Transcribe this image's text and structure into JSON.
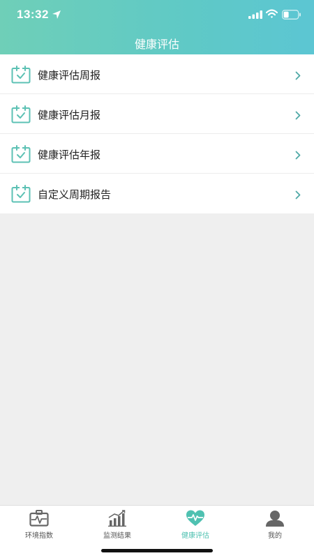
{
  "status": {
    "time": "13:32",
    "icons": [
      "location-arrow-icon",
      "signal-icon",
      "wifi-icon",
      "battery-icon"
    ]
  },
  "header": {
    "title": "健康评估"
  },
  "menu": {
    "items": [
      {
        "label": "健康评估周报",
        "icon": "calendar-check-icon"
      },
      {
        "label": "健康评估月报",
        "icon": "calendar-check-icon"
      },
      {
        "label": "健康评估年报",
        "icon": "calendar-check-icon"
      },
      {
        "label": "自定义周期报告",
        "icon": "calendar-check-icon"
      }
    ]
  },
  "tabbar": {
    "tabs": [
      {
        "label": "环境指数",
        "icon": "medkit-icon",
        "active": false
      },
      {
        "label": "监测结果",
        "icon": "bar-chart-icon",
        "active": false
      },
      {
        "label": "健康评估",
        "icon": "heart-pulse-icon",
        "active": true
      },
      {
        "label": "我的",
        "icon": "person-icon",
        "active": false
      }
    ]
  },
  "colors": {
    "accent": "#4fc1b1",
    "header_gradient_start": "#6fcfb8",
    "header_gradient_end": "#5cc6d3",
    "inactive_icon": "#666666",
    "background": "#efefef"
  }
}
